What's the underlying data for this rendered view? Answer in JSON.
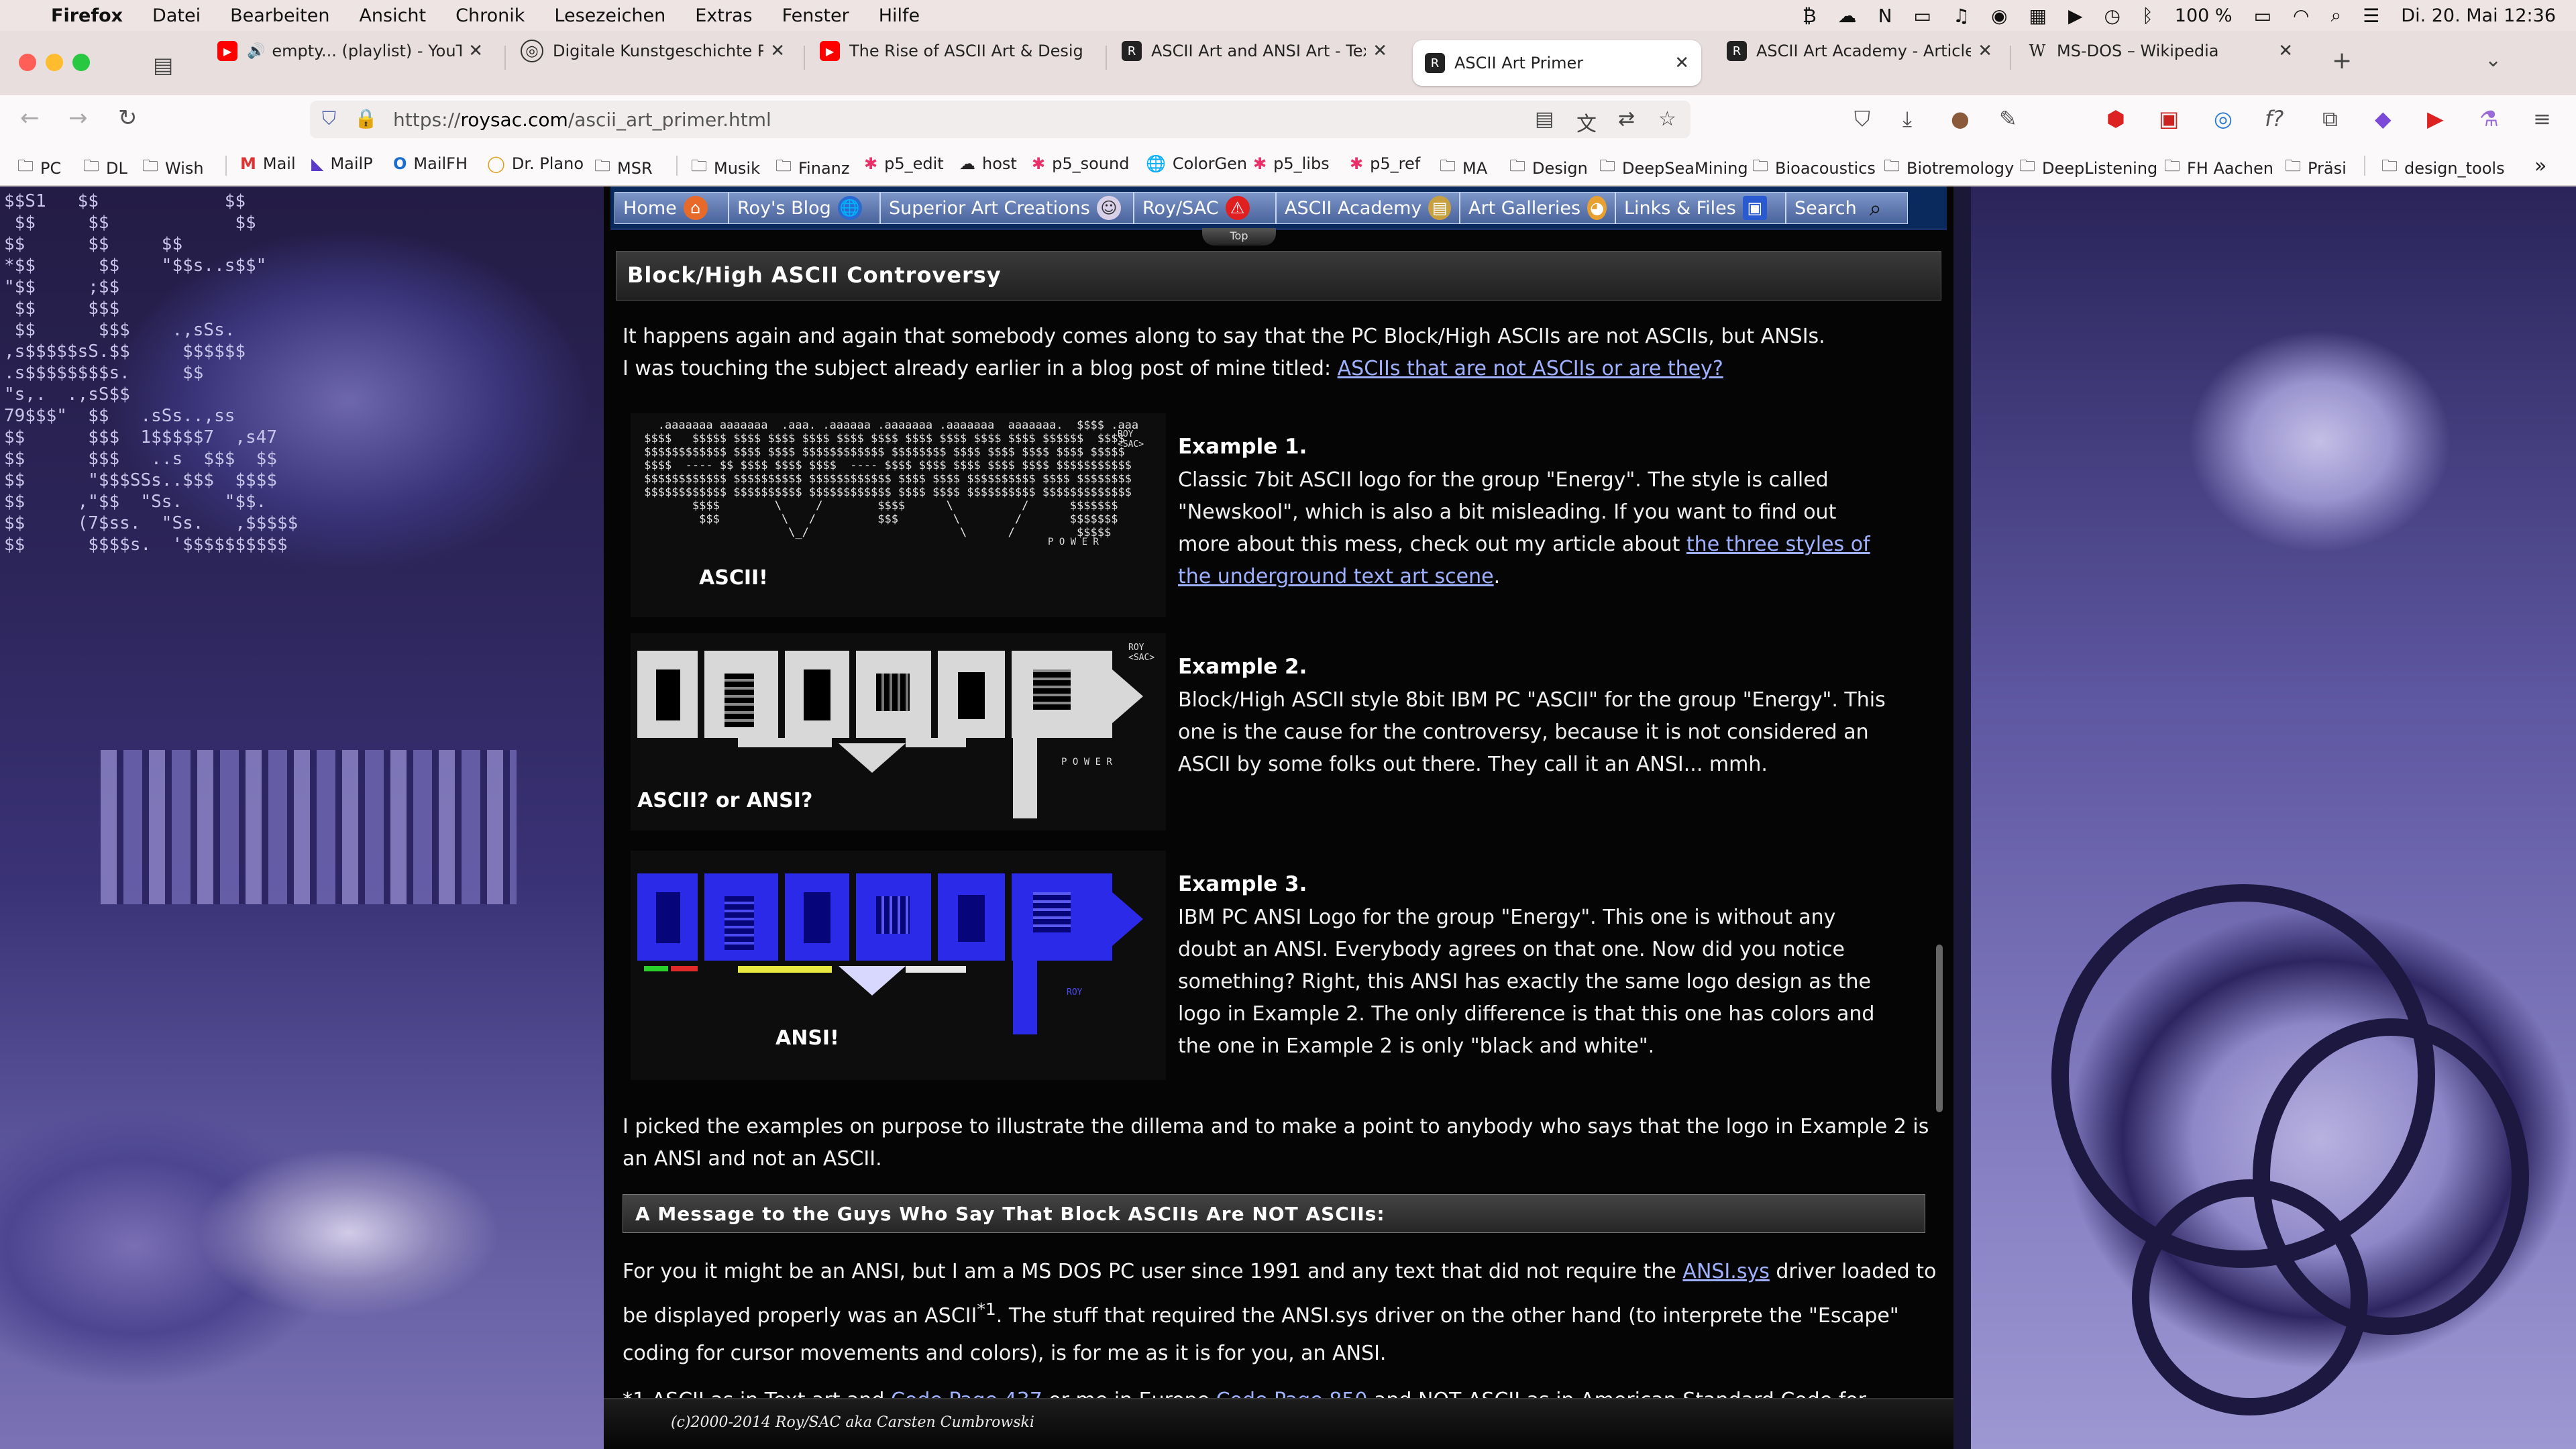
{
  "menubar": {
    "app": "Firefox",
    "items": [
      "Datei",
      "Bearbeiten",
      "Ansicht",
      "Chronik",
      "Lesezeichen",
      "Extras",
      "Fenster",
      "Hilfe"
    ],
    "battery": "100 %",
    "datetime": "Di. 20. Mai  12:36"
  },
  "tabs": [
    {
      "title": "empty... (playlist) - YouTube",
      "icon": "youtube-icon",
      "active": false
    },
    {
      "title": "Digitale Kunstgeschichte Präse",
      "icon": "globe-icon",
      "active": false
    },
    {
      "title": "The Rise of ASCII Art & Design -",
      "icon": "youtube-icon",
      "active": false
    },
    {
      "title": "ASCII Art and ANSI Art - Text Ar",
      "icon": "roysac-icon",
      "active": false
    },
    {
      "title": "ASCII Art Primer",
      "icon": "roysac-icon",
      "active": true
    },
    {
      "title": "ASCII Art Academy - Articles an",
      "icon": "roysac-icon",
      "active": false
    },
    {
      "title": "MS-DOS – Wikipedia",
      "icon": "wikipedia-icon",
      "active": false
    }
  ],
  "navbar": {
    "url_prefix": "https://",
    "url_domain": "roysac.com",
    "url_path": "/ascii_art_primer.html"
  },
  "bookmarks": [
    {
      "label": "PC",
      "icon": "folder-icon"
    },
    {
      "label": "DL",
      "icon": "folder-icon"
    },
    {
      "label": "Wish",
      "icon": "folder-icon"
    },
    {
      "label": "Mail",
      "icon": "gmail-icon"
    },
    {
      "label": "MailP",
      "icon": "mail-icon"
    },
    {
      "label": "MailFH",
      "icon": "outlook-icon"
    },
    {
      "label": "Dr. Plano",
      "icon": "ring-icon"
    },
    {
      "label": "MSR",
      "icon": "folder-icon"
    },
    {
      "label": "Musik",
      "icon": "folder-icon"
    },
    {
      "label": "Finanz",
      "icon": "folder-icon"
    },
    {
      "label": "p5_edit",
      "icon": "star-icon"
    },
    {
      "label": "host",
      "icon": "cloud-icon"
    },
    {
      "label": "p5_sound",
      "icon": "star-icon"
    },
    {
      "label": "ColorGen",
      "icon": "globe-icon"
    },
    {
      "label": "p5_libs",
      "icon": "star-icon"
    },
    {
      "label": "p5_ref",
      "icon": "star-icon"
    },
    {
      "label": "MA",
      "icon": "folder-icon"
    },
    {
      "label": "Design",
      "icon": "folder-icon"
    },
    {
      "label": "DeepSeaMining",
      "icon": "folder-icon"
    },
    {
      "label": "Bioacoustics",
      "icon": "folder-icon"
    },
    {
      "label": "Biotremology",
      "icon": "folder-icon"
    },
    {
      "label": "DeepListening",
      "icon": "folder-icon"
    },
    {
      "label": "FH Aachen",
      "icon": "folder-icon"
    },
    {
      "label": "Präsi",
      "icon": "folder-icon"
    },
    {
      "label": "design_tools",
      "icon": "folder-icon"
    }
  ],
  "sitenav": [
    {
      "label": "Home",
      "icon": "house-icon"
    },
    {
      "label": "Roy's Blog",
      "icon": "globe-icon"
    },
    {
      "label": "Superior Art Creations",
      "icon": "palette-icon"
    },
    {
      "label": "Roy/SAC",
      "icon": "warning-icon"
    },
    {
      "label": "ASCII Academy",
      "icon": "books-icon"
    },
    {
      "label": "Art Galleries",
      "icon": "palette-icon"
    },
    {
      "label": "Links & Files",
      "icon": "disk-icon"
    },
    {
      "label": "Search",
      "icon": "magnifier-icon"
    }
  ],
  "top_tab": "Top",
  "section_title": "Block/High ASCII Controversy",
  "intro": {
    "line1": "It happens again and again that somebody comes along to say that the PC Block/High ASCIIs are not ASCIIs, but ANSIs.",
    "line2_prefix": "I was touching the subject already earlier in a blog post of mine titled: ",
    "line2_link": "ASCIIs that are not ASCIIs or are they?"
  },
  "examples": [
    {
      "heading": "Example 1.",
      "caption": "ASCII!",
      "text_before": "Classic 7bit ASCII logo for the group \"Energy\". The style is called \"Newskool\", which is also a bit misleading. If you want to find out more about this mess, check out my article about ",
      "link": "the three styles of the underground text art scene",
      "text_after": "."
    },
    {
      "heading": "Example 2.",
      "caption": "ASCII? or ANSI?",
      "text": "Block/High ASCII style 8bit IBM PC \"ASCII\" for the group \"Energy\". This one is the cause for the controversy, because it is not considered an ASCII by some folks out there. They call it an ANSI... mmh."
    },
    {
      "heading": "Example 3.",
      "caption": "ANSI!",
      "text": "IBM PC ANSI Logo for the group \"Energy\". This one is without any doubt an ANSI. Everybody agrees on that one. Now did you notice something? Right, this ANSI has exactly the same logo design as the logo in Example 2. The only difference is that this one has colors and the one in Example 2 is only \"black and white\"."
    }
  ],
  "art_tags": {
    "ex1_tag": "ROY\n<SAC>",
    "ex1_word": "P O W E R",
    "ex2_tag": "ROY\n<SAC>",
    "ex2_word": "P O W E R",
    "ex3_tag": "ROY"
  },
  "conclusion": "I picked the examples on purpose to illustrate the dillema and to make a point to anybody who says that the logo in Example 2 is an ANSI and not an ASCII.",
  "message_title": "A Message to the Guys Who Say That Block ASCIIs Are NOT ASCIIs:",
  "message": {
    "p1_prefix": "For you it might be an ANSI, but I am a MS DOS PC user since 1991 and any text that did not require the ",
    "p1_link": "ANSI.sys",
    "p1_mid": " driver loaded to be displayed properly was an ASCII",
    "p1_sup": "*1",
    "p1_suffix": ". The stuff that required the ANSI.sys driver on the other hand (to interprete the \"Escape\" coding for cursor movements and colors), is for me as it is for you, an ANSI.",
    "footnote_prefix": "*1 ASCII as in Text art and ",
    "footnote_link1": "Code Page 437",
    "footnote_mid": " or me in Europe ",
    "footnote_link2": "Code Page 850",
    "footnote_suffix": " and NOT ASCII as in American Standard Code for"
  },
  "footer": "(c)2000-2014 Roy/SAC aka Carsten Cumbrowski",
  "colors": {
    "link": "#9fb0ff",
    "ansi_blue": "#2a2ae8",
    "sitenav_bg": "#0a2a5e"
  }
}
